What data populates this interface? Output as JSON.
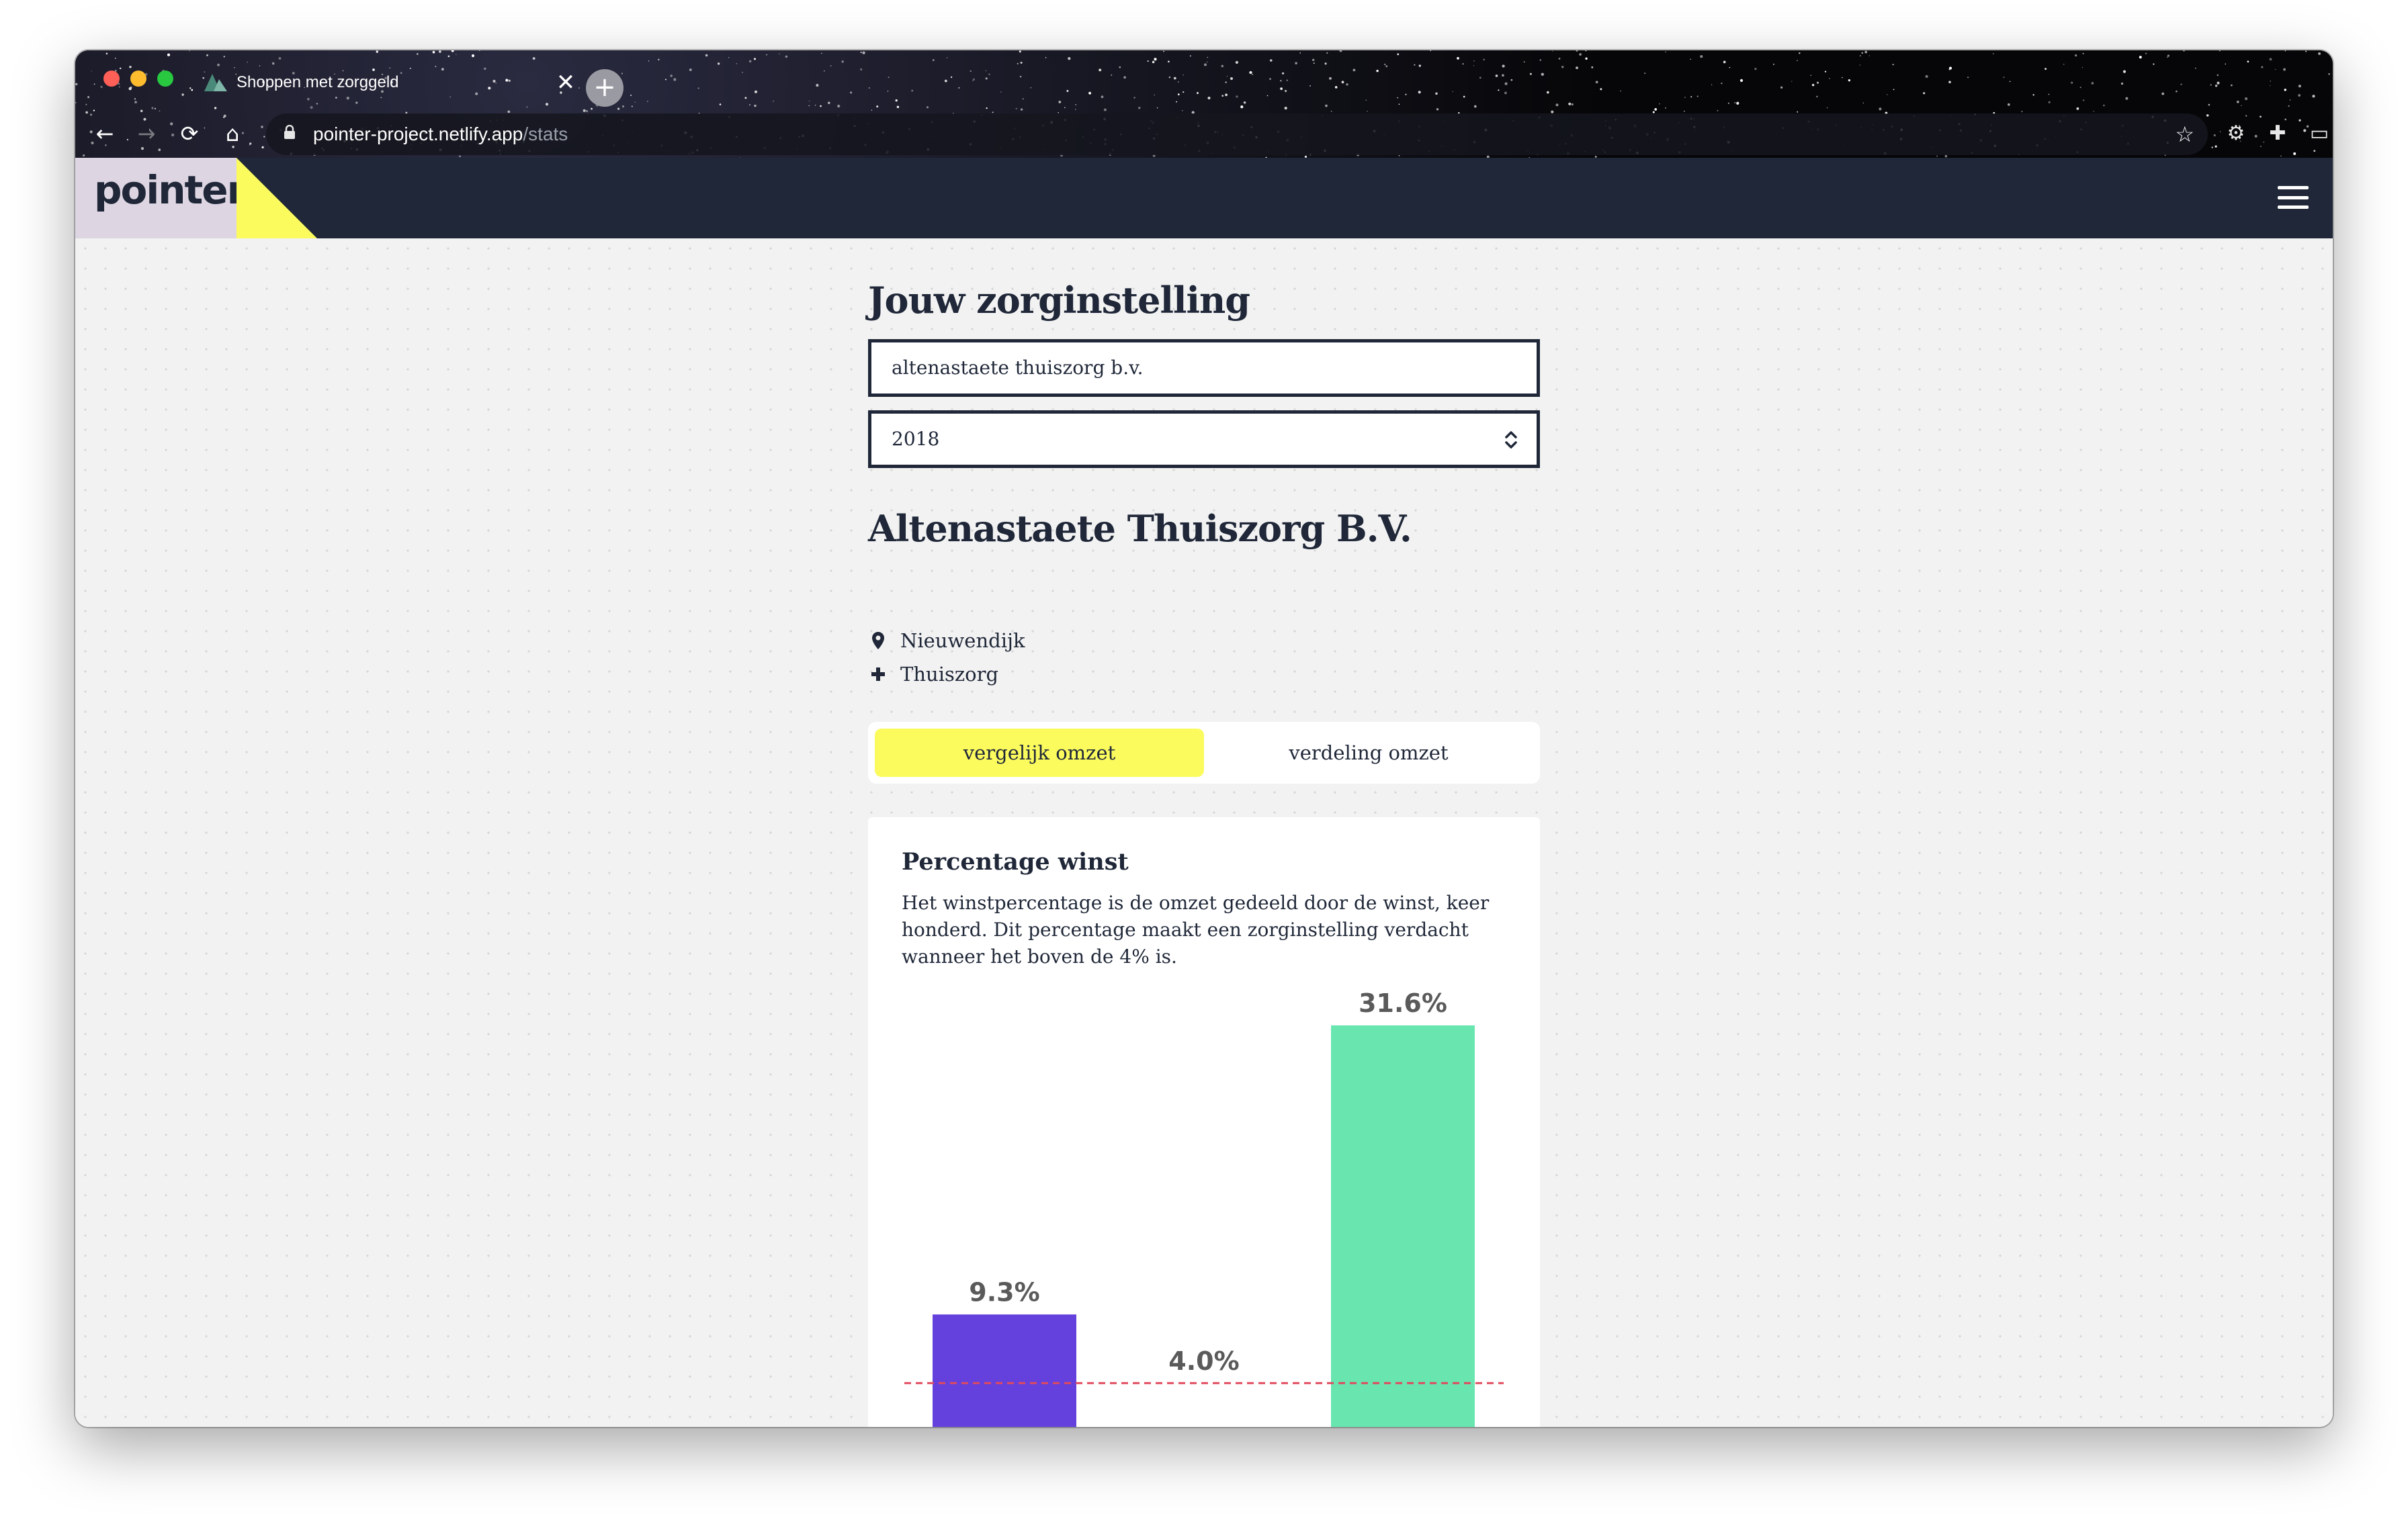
{
  "browser": {
    "tab_title": "Shoppen met zorggeld",
    "tab_close": "✕",
    "new_tab": "+",
    "url_host": "pointer-project.netlify.app",
    "url_path": "/stats"
  },
  "site": {
    "logo": "pointer",
    "accent_color": "#fbfb5e",
    "header_color": "#1f2738"
  },
  "form": {
    "title": "Jouw zorginstelling",
    "search_value": "altenastaete thuiszorg b.v.",
    "year_value": "2018"
  },
  "organization": {
    "name": "Altenastaete Thuiszorg B.V.",
    "location": "Nieuwendijk",
    "category": "Thuiszorg"
  },
  "toggle": {
    "compare_label": "vergelijk omzet",
    "distribution_label": "verdeling omzet"
  },
  "card": {
    "title": "Percentage winst",
    "description": "Het winstpercentage is de omzet gedeeld door de winst, keer honderd. Dit percentage maakt een zorginstelling verdacht wanneer het boven de 4% is."
  },
  "chart_data": {
    "type": "bar",
    "values": [
      9.3,
      4.0,
      31.6
    ],
    "labels": [
      "9.3%",
      "4.0%",
      "31.6%"
    ],
    "colors": [
      "#6441dd",
      "#ffffff",
      "#69e5b0"
    ],
    "threshold": 4.0,
    "threshold_color": "#e04a5e",
    "ylim": [
      0,
      31.6
    ]
  }
}
